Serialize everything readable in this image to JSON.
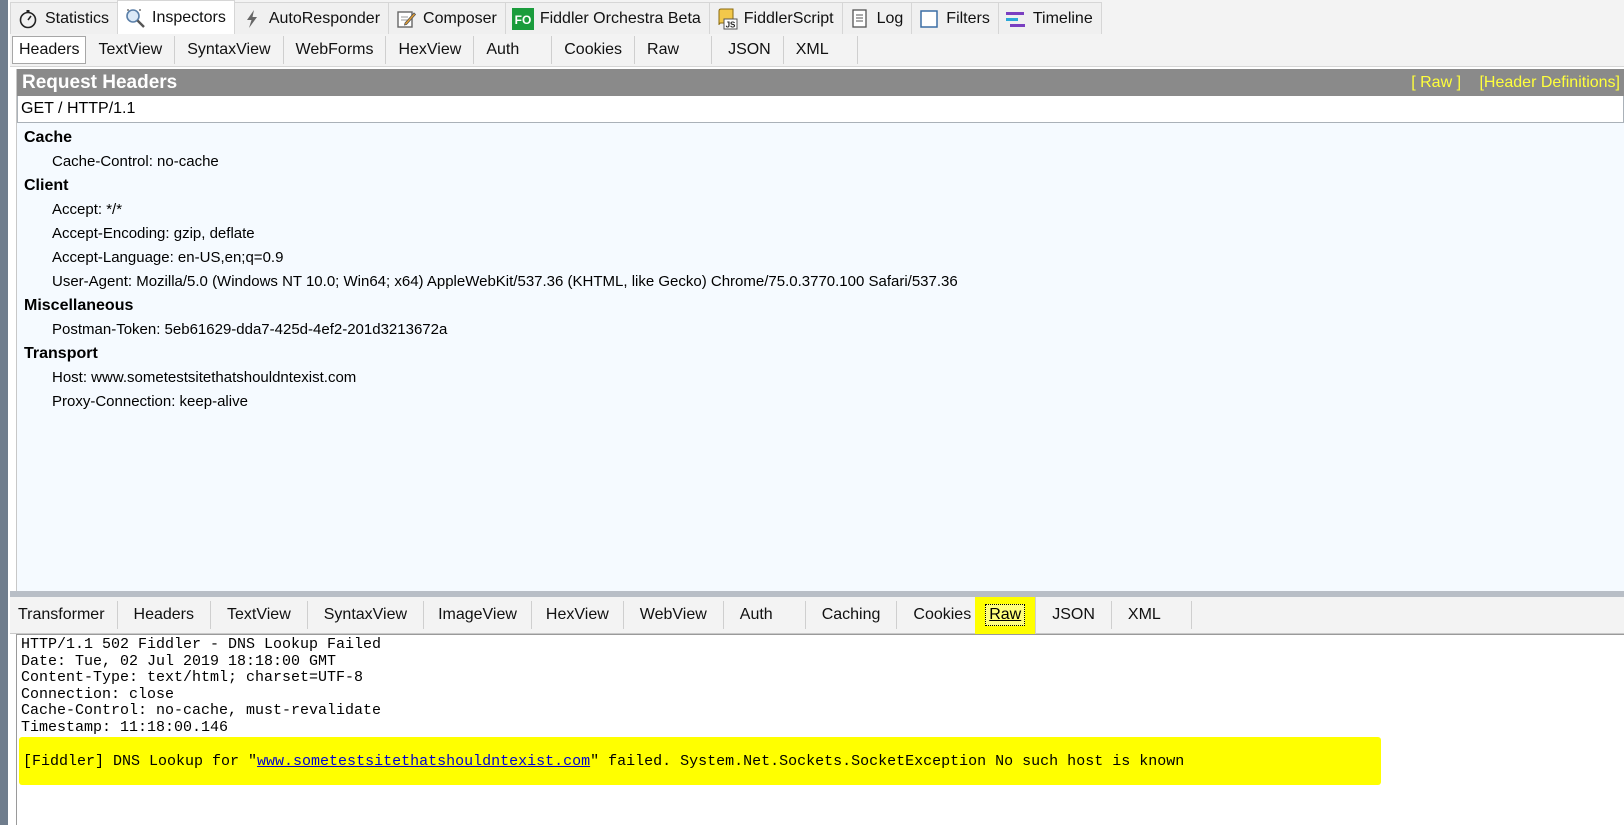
{
  "top_tabs": [
    {
      "label": "Statistics",
      "icon": "stopwatch-icon"
    },
    {
      "label": "Inspectors",
      "icon": "magnifier-icon",
      "active": true
    },
    {
      "label": "AutoResponder",
      "icon": "lightning-icon"
    },
    {
      "label": "Composer",
      "icon": "composer-icon"
    },
    {
      "label": "Fiddler Orchestra Beta",
      "icon": "fo-icon",
      "icon_text": "FO"
    },
    {
      "label": "FiddlerScript",
      "icon": "script-icon",
      "icon_text": "JS"
    },
    {
      "label": "Log",
      "icon": "log-icon"
    },
    {
      "label": "Filters",
      "icon": "filters-checkbox-icon"
    },
    {
      "label": "Timeline",
      "icon": "timeline-icon"
    }
  ],
  "request_tabs": [
    "Headers",
    "TextView",
    "SyntaxView",
    "WebForms",
    "HexView",
    "Auth",
    "Cookies",
    "Raw",
    "JSON",
    "XML"
  ],
  "request_active_tab": "Headers",
  "request_headers": {
    "title": "Request Headers",
    "raw_link": "[ Raw ]",
    "definitions_link": "[Header Definitions]",
    "request_line": "GET / HTTP/1.1",
    "groups": [
      {
        "name": "Cache",
        "headers": [
          "Cache-Control: no-cache"
        ]
      },
      {
        "name": "Client",
        "headers": [
          "Accept: */*",
          "Accept-Encoding: gzip, deflate",
          "Accept-Language: en-US,en;q=0.9",
          "User-Agent: Mozilla/5.0 (Windows NT 10.0; Win64; x64) AppleWebKit/537.36 (KHTML, like Gecko) Chrome/75.0.3770.100 Safari/537.36"
        ]
      },
      {
        "name": "Miscellaneous",
        "headers": [
          "Postman-Token: 5eb61629-dda7-425d-4ef2-201d3213672a"
        ]
      },
      {
        "name": "Transport",
        "headers": [
          "Host: www.sometestsitethatshouldntexist.com",
          "Proxy-Connection: keep-alive"
        ]
      }
    ]
  },
  "response_tabs": [
    "Transformer",
    "Headers",
    "TextView",
    "SyntaxView",
    "ImageView",
    "HexView",
    "WebView",
    "Auth",
    "Caching",
    "Cookies",
    "Raw",
    "JSON",
    "XML"
  ],
  "response_active_tab": "Raw",
  "raw_response": {
    "lines": [
      "HTTP/1.1 502 Fiddler - DNS Lookup Failed",
      "Date: Tue, 02 Jul 2019 18:18:00 GMT",
      "Content-Type: text/html; charset=UTF-8",
      "Connection: close",
      "Cache-Control: no-cache, must-revalidate",
      "Timestamp: 11:18:00.146"
    ],
    "body_prefix": "[Fiddler] DNS Lookup for \"",
    "body_link": "www.sometestsitethatshouldntexist.com",
    "body_suffix": "\" failed. System.Net.Sockets.SocketException No such host is known "
  },
  "colors": {
    "highlight": "#ffff00",
    "title_bar": "#8a8a8a",
    "title_link": "#ffff3c",
    "panel_bg": "#f5faff"
  }
}
